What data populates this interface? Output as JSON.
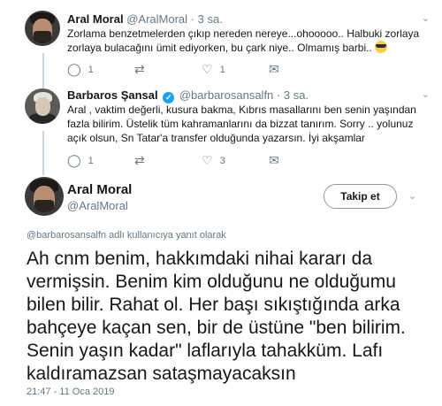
{
  "replies": [
    {
      "name": "Aral Moral",
      "handle": "@AralMoral",
      "time": "3 sa.",
      "text": "Zorlama benzetmelerden çıkıp nereden nereye...ohooooo.. Halbuki zorlaya zorlaya bulacağını ümit ediyorken, bu çark niye.. Olmamış barbi..",
      "emoji": "sunglasses-emoji",
      "replies_count": "1",
      "retweets_count": "",
      "likes_count": "1"
    },
    {
      "name": "Barbaros Şansal",
      "handle": "@barbarosansalfn",
      "time": "3 sa.",
      "verified": true,
      "text": "Aral , vaktim değerli, kusura bakma, Kıbrıs masallarını ben senin yaşından fazla bilirim. Üstelik tüm kahramanlarını da bizzat tanırım. Sorry .. yolunuz açık olsun, Sn Tatar'a transfer olduğunda yazarsın. İyi akşamlar",
      "replies_count": "1",
      "retweets_count": "",
      "likes_count": "3"
    }
  ],
  "main_tweet": {
    "name": "Aral Moral",
    "handle": "@AralMoral",
    "follow_label": "Takip et",
    "replying_handle": "@barbarosansalfn",
    "replying_suffix": "adlı kullanıcıya yanıt olarak",
    "text": "Ah cnm benim, hakkımdaki nihai kararı da vermişsin. Benim kim olduğunu ne olduğumu bilen bilir. Rahat ol. Her başı sıkıştığında arka bahçeye kaçan sen, bir de üstüne \"ben bilirim. Senin yaşın kadar\" laflarıyla tahakküm. Lafı kaldıramazsan sataşmayacaksın",
    "timestamp": "21:47 - 11 Oca 2019"
  },
  "icons": {
    "reply": "reply-icon",
    "retweet": "retweet-icon",
    "like": "heart-icon",
    "message": "message-icon",
    "more": "chevron-down-icon"
  },
  "colors": {
    "text": "#14171a",
    "muted": "#657786",
    "thread_line": "#ccd6dd",
    "verified": "#1da1f2"
  }
}
